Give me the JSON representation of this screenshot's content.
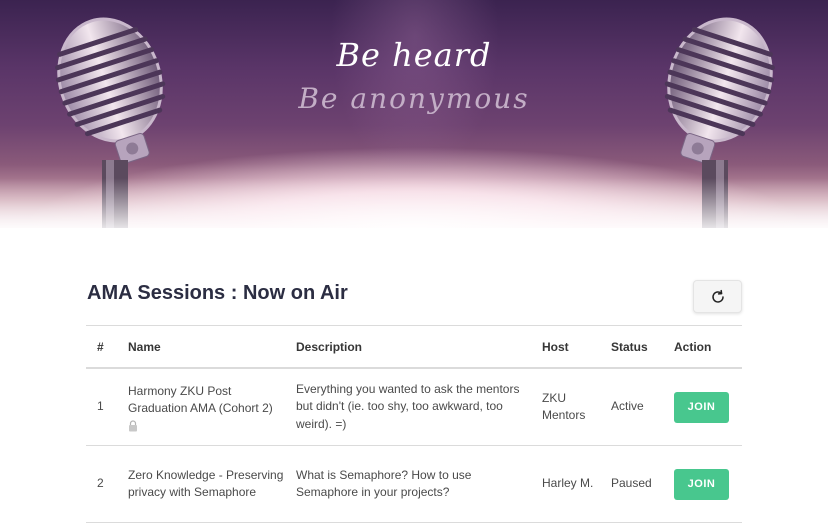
{
  "hero": {
    "tagline_primary": "Be heard",
    "tagline_secondary": "Be anonymous"
  },
  "sessions_section": {
    "title": "AMA Sessions : Now on Air",
    "refresh_icon": "refresh-icon"
  },
  "table": {
    "headers": {
      "num": "#",
      "name": "Name",
      "description": "Description",
      "host": "Host",
      "status": "Status",
      "action": "Action"
    },
    "rows": [
      {
        "num": "1",
        "name": "Harmony ZKU Post Graduation AMA (Cohort 2)",
        "locked_icon": "lock-icon",
        "description": "Everything you wanted to ask the mentors but didn't (ie. too shy, too awkward, too weird). =)",
        "host": "ZKU Mentors",
        "status": "Active",
        "action_label": "JOIN"
      },
      {
        "num": "2",
        "name": "Zero Knowledge - Preserving privacy with Semaphore",
        "description": "What is Semaphore? How to use Semaphore in your projects?",
        "host": "Harley M.",
        "status": "Paused",
        "action_label": "JOIN"
      }
    ]
  },
  "colors": {
    "join_button": "#48c78e",
    "title_text": "#2b2d42",
    "hero_purple": "#5a3568"
  }
}
